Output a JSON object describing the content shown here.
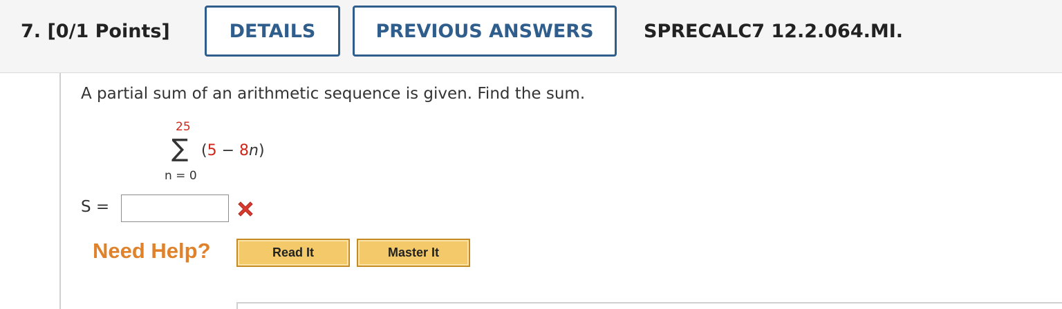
{
  "header": {
    "question_number": "7.",
    "points": "[0/1 Points]",
    "details_label": "DETAILS",
    "previous_answers_label": "PREVIOUS ANSWERS",
    "question_code": "SPRECALC7 12.2.064.MI."
  },
  "question": {
    "prompt": "A partial sum of an arithmetic sequence is given. Find the sum.",
    "summation": {
      "upper_limit": "25",
      "sigma": "∑",
      "expr_open": "(",
      "expr_first": "5",
      "expr_op": " − ",
      "expr_coef": "8",
      "expr_var": "n",
      "expr_close": ")",
      "lower_limit": "n = 0"
    },
    "answer_label": "S =",
    "answer_value": "",
    "status_icon": "red-cross-icon"
  },
  "help": {
    "label": "Need Help?",
    "read_it": "Read It",
    "master_it": "Master It"
  },
  "colors": {
    "accent_blue": "#2f5d8c",
    "error_red": "#d0261a",
    "help_orange": "#e0822b",
    "button_gold": "#f4c969"
  }
}
